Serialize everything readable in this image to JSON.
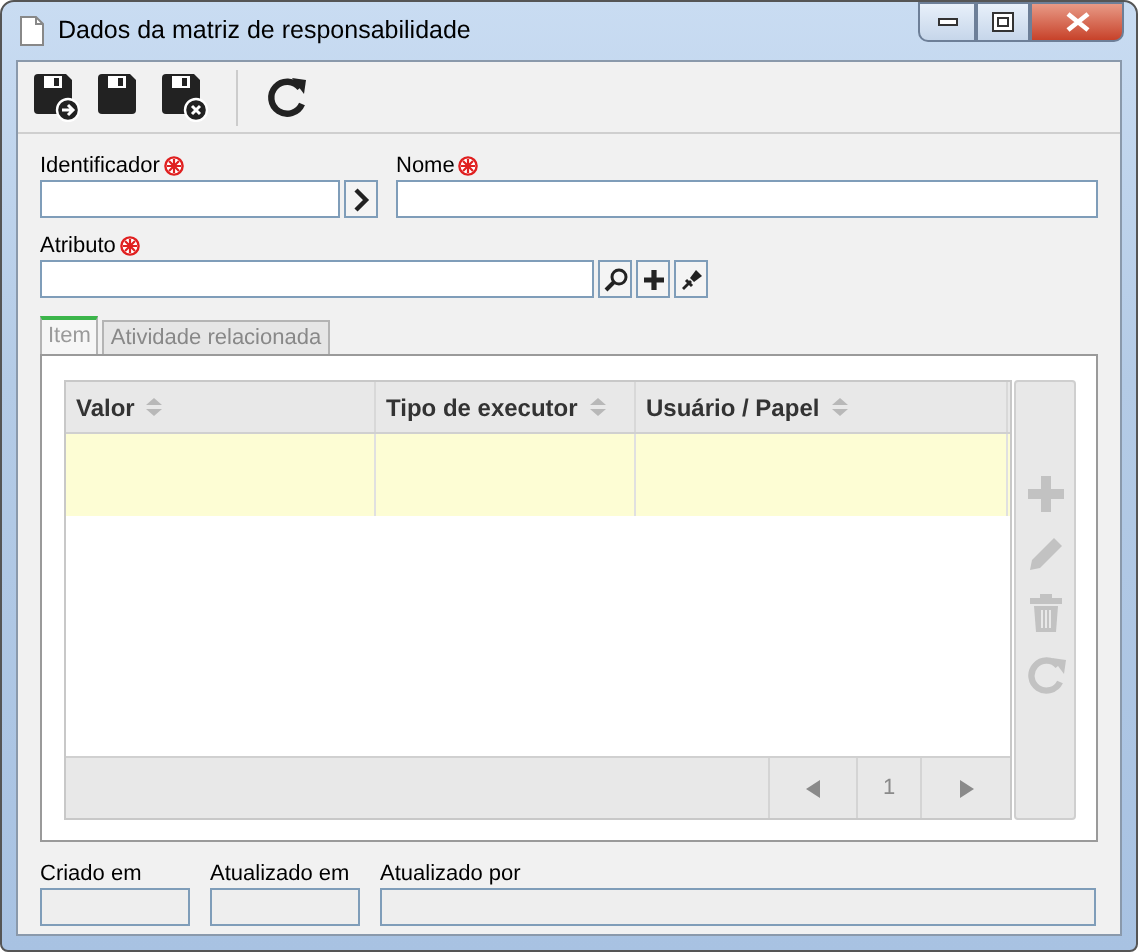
{
  "window": {
    "title": "Dados da matriz de responsabilidade"
  },
  "fields": [
    {
      "label": "Identificador",
      "required": true
    },
    {
      "label": "Nome",
      "required": true
    },
    {
      "label": "Atributo",
      "required": true
    }
  ],
  "tabs": [
    {
      "label": "Item",
      "selected": true
    },
    {
      "label": "Atividade relacionada",
      "selected": false
    }
  ],
  "grid": {
    "columns": [
      "Valor",
      "Tipo de executor",
      "Usuário / Papel"
    ],
    "rows": [
      {
        "selected": true
      }
    ],
    "pager": {
      "page": "1",
      "disabled": true
    },
    "actions_disabled": true
  },
  "footer_fields": [
    {
      "label": "Criado em",
      "disabled": true
    },
    {
      "label": "Atualizado em",
      "disabled": true
    },
    {
      "label": "Atualizado por",
      "disabled": true
    }
  ]
}
